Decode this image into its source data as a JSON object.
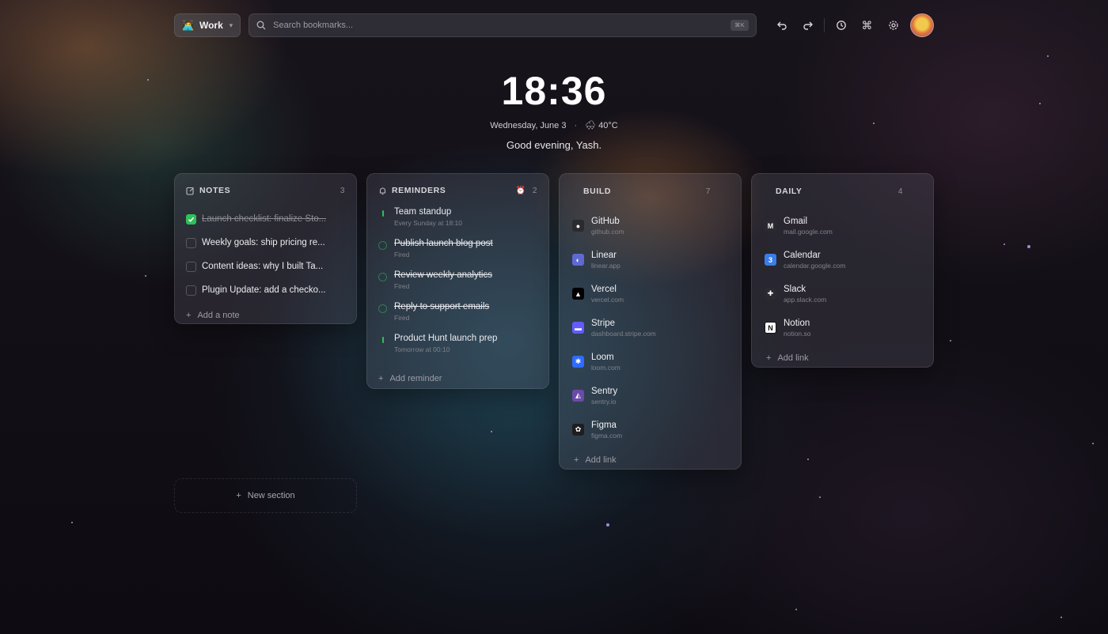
{
  "topbar": {
    "workspace": {
      "emoji": "🧑‍💻",
      "label": "Work"
    },
    "search": {
      "placeholder": "Search bookmarks...",
      "shortcut": "⌘K"
    }
  },
  "clock": {
    "time": "18:36",
    "date": "Wednesday, June 3",
    "weather_icon": "🌨",
    "temperature": "40°C",
    "greeting": "Good evening, Yash."
  },
  "notes": {
    "title": "NOTES",
    "count": "3",
    "items": [
      {
        "text": "Launch checklist: finalize Sto...",
        "done": true
      },
      {
        "text": "Weekly goals: ship pricing re...",
        "done": false
      },
      {
        "text": "Content ideas: why I built Ta...",
        "done": false
      },
      {
        "text": "Plugin Update: add a checko...",
        "done": false
      }
    ],
    "add_label": "Add a note"
  },
  "reminders": {
    "title": "REMINDERS",
    "count": "2",
    "items": [
      {
        "title": "Team standup",
        "sub": "Every Sunday at 18:10",
        "fired": false
      },
      {
        "title": "Publish launch blog post",
        "sub": "Fired",
        "fired": true
      },
      {
        "title": "Review weekly analytics",
        "sub": "Fired",
        "fired": true
      },
      {
        "title": "Reply to support emails",
        "sub": "Fired",
        "fired": true
      },
      {
        "title": "Product Hunt launch prep",
        "sub": "Tomorrow at 00:10",
        "fired": false
      }
    ],
    "add_label": "Add reminder"
  },
  "build": {
    "title": "BUILD",
    "count": "7",
    "links": [
      {
        "name": "GitHub",
        "url": "github.com",
        "icon": "github-icon",
        "color": "#2b2b2f",
        "glyph": "●"
      },
      {
        "name": "Linear",
        "url": "linear.app",
        "icon": "linear-icon",
        "color": "#5e6ad2",
        "glyph": "◐"
      },
      {
        "name": "Vercel",
        "url": "vercel.com",
        "icon": "vercel-icon",
        "color": "#000000",
        "glyph": "▲"
      },
      {
        "name": "Stripe",
        "url": "dashboard.stripe.com",
        "icon": "stripe-icon",
        "color": "#635bff",
        "glyph": "▬"
      },
      {
        "name": "Loom",
        "url": "loom.com",
        "icon": "loom-icon",
        "color": "#2f6bff",
        "glyph": "✱"
      },
      {
        "name": "Sentry",
        "url": "sentry.io",
        "icon": "sentry-icon",
        "color": "#6c4aa8",
        "glyph": "◭"
      },
      {
        "name": "Figma",
        "url": "figma.com",
        "icon": "figma-icon",
        "color": "#1e1e1e",
        "glyph": "✿"
      }
    ],
    "add_label": "Add link"
  },
  "daily": {
    "title": "DAILY",
    "count": "4",
    "links": [
      {
        "name": "Gmail",
        "url": "mail.google.com",
        "icon": "gmail-icon",
        "color": "#2a2a30",
        "glyph": "M"
      },
      {
        "name": "Calendar",
        "url": "calendar.google.com",
        "icon": "calendar-icon",
        "color": "#3b7de8",
        "glyph": "3"
      },
      {
        "name": "Slack",
        "url": "app.slack.com",
        "icon": "slack-icon",
        "color": "#2a2a30",
        "glyph": "✚"
      },
      {
        "name": "Notion",
        "url": "notion.so",
        "icon": "notion-icon",
        "color": "#ffffff",
        "glyph": "N"
      }
    ],
    "add_label": "Add link"
  },
  "new_section_label": "New section",
  "colors": {
    "accent_green": "#2fc05b",
    "card_bg": "rgba(120,120,135,0.22)"
  }
}
